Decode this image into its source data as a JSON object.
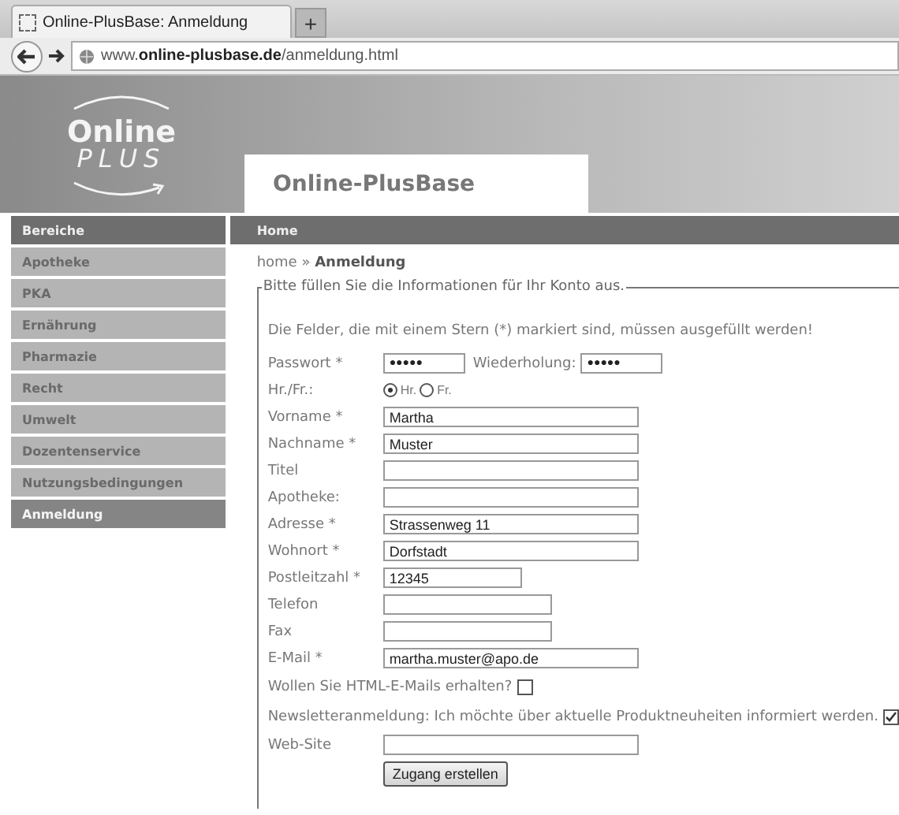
{
  "browser": {
    "tab_title": "Online-PlusBase: Anmeldung",
    "new_tab": "+",
    "url": "www.**online-plusbase.de**/anmeldung.html"
  },
  "header": {
    "logo_top": "Online",
    "logo_bottom": "PLUS",
    "site_title": "Online-PlusBase"
  },
  "sidebar": {
    "heading": "Bereiche",
    "items": [
      {
        "label": "Apotheke",
        "selected": false
      },
      {
        "label": "PKA",
        "selected": false
      },
      {
        "label": "Ernährung",
        "selected": false
      },
      {
        "label": "Pharmazie",
        "selected": false
      },
      {
        "label": "Recht",
        "selected": false
      },
      {
        "label": "Umwelt",
        "selected": false
      },
      {
        "label": "Dozentenservice",
        "selected": false
      },
      {
        "label": "Nutzungsbedingungen",
        "selected": false
      },
      {
        "label": "Anmeldung",
        "selected": true
      }
    ]
  },
  "content": {
    "heading": "Home",
    "breadcrumb": "home » **Anmeldung**"
  },
  "form": {
    "legend": "Bitte füllen Sie die Informationen für Ihr Konto aus.",
    "note": "Die Felder, die mit einem Stern (*) markiert sind, müssen ausgefüllt werden!",
    "rows": [
      {
        "kind": "password",
        "label": "Passwort *",
        "value": "●●●●●",
        "repeat_label": "Wiederholung:",
        "repeat_value": "●●●●●"
      },
      {
        "kind": "radio",
        "label": "Hr./Fr.:",
        "options": [
          {
            "label": "Hr.",
            "selected": true
          },
          {
            "label": "Fr.",
            "selected": false
          }
        ]
      },
      {
        "kind": "longfield",
        "label": "Vorname *",
        "value": "Martha"
      },
      {
        "kind": "longfield",
        "label": "Nachname *",
        "value": "Muster"
      },
      {
        "kind": "longfield",
        "label": "Titel"
      },
      {
        "kind": "longfield",
        "label": "Apotheke:"
      },
      {
        "kind": "longfield",
        "label": "Adresse *",
        "value": "Strassenweg 11"
      },
      {
        "kind": "longfield",
        "label": "Wohnort *",
        "value": "Dorfstadt"
      },
      {
        "kind": "shortfield",
        "label": "Postleitzahl *",
        "value": "12345"
      },
      {
        "kind": "midfield",
        "label": "Telefon"
      },
      {
        "kind": "midfield",
        "label": "Fax"
      },
      {
        "kind": "longfield",
        "label": "E-Mail *",
        "value": "martha.muster@apo.de"
      },
      {
        "kind": "checkbox",
        "label": "Wollen Sie HTML-E-Mails erhalten?",
        "checked": false
      },
      {
        "kind": "checkbox",
        "label": "Newsletteranmeldung: Ich möchte über aktuelle Produktneuheiten informiert werden.",
        "checked": true
      },
      {
        "kind": "longfield",
        "label": "Web-Site"
      },
      {
        "kind": "button",
        "label": "Zugang erstellen"
      }
    ]
  }
}
